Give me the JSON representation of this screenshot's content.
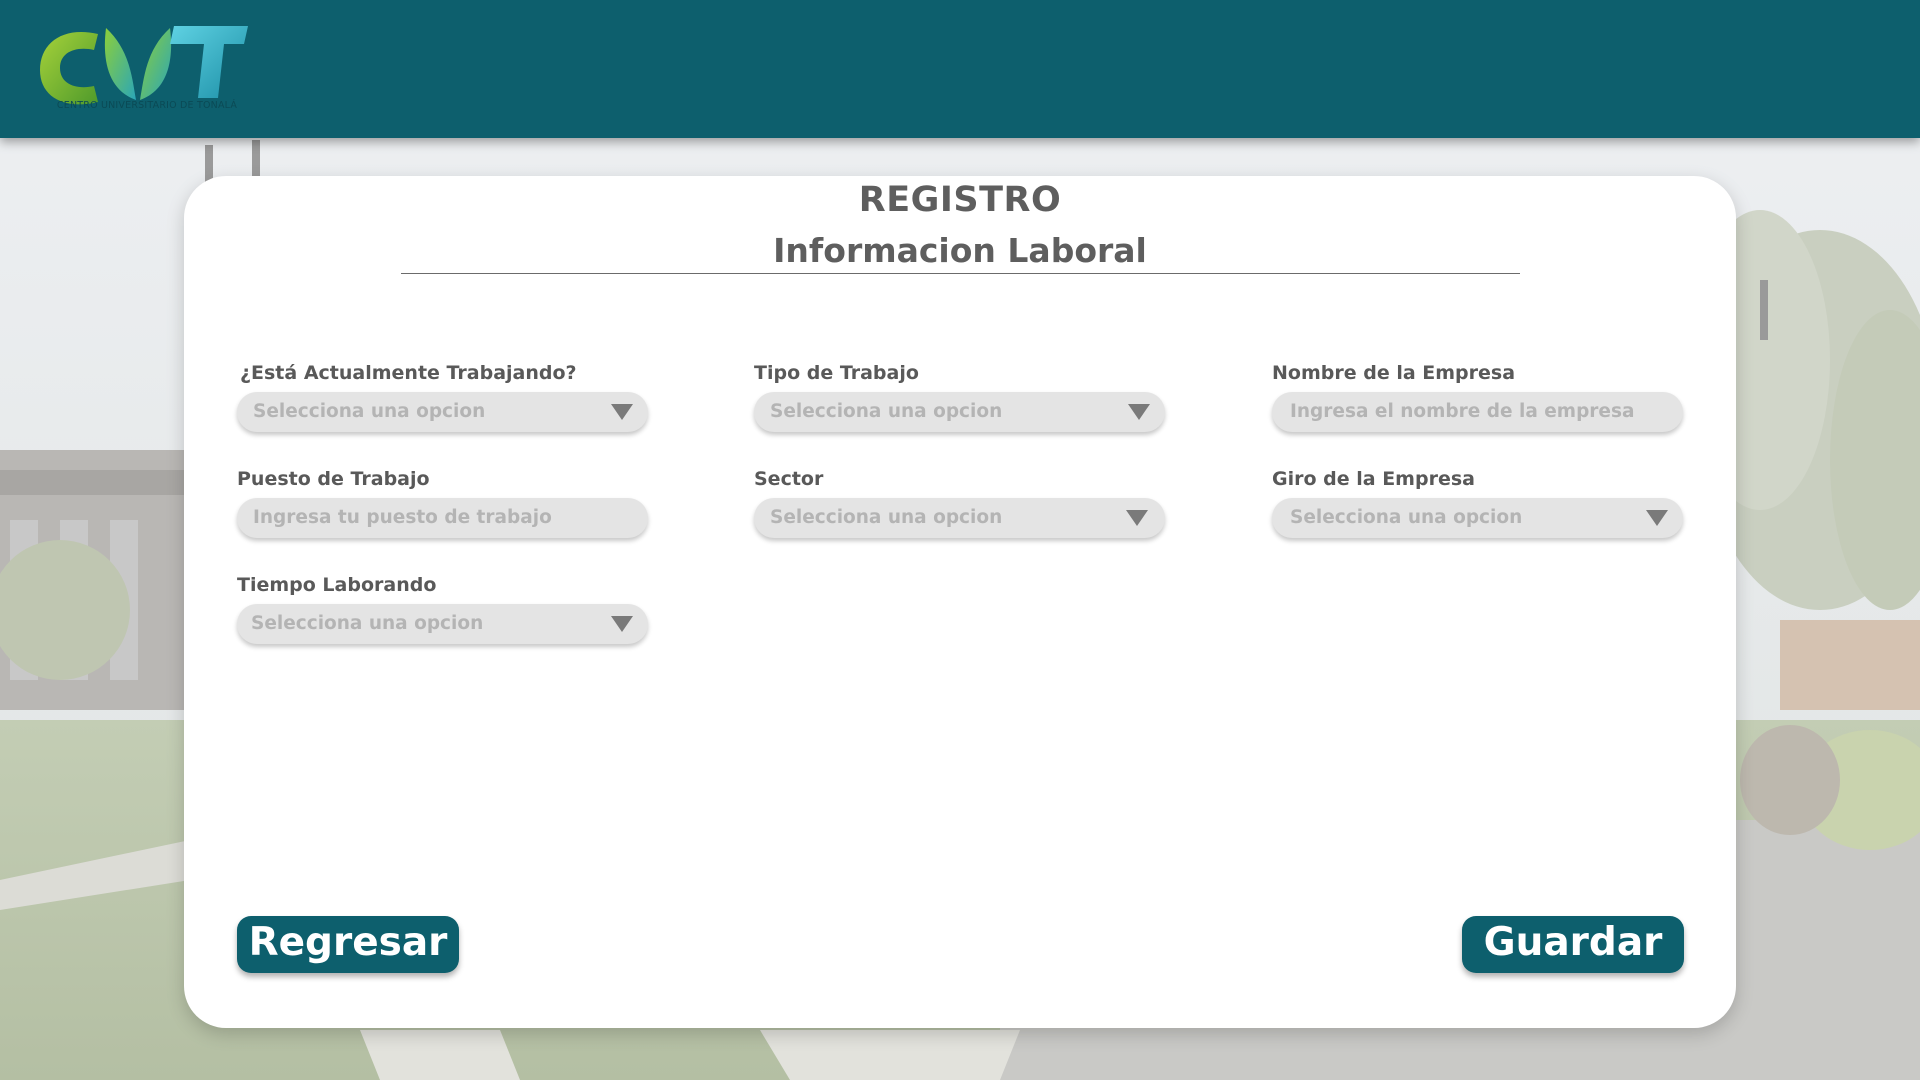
{
  "header": {
    "logo_letters": "CUT",
    "logo_caption": "CENTRO UNIVERSITARIO DE TONALÁ"
  },
  "form": {
    "title": "REGISTRO",
    "subtitle": "Informacion Laboral",
    "fields": {
      "working": {
        "label": "¿Está Actualmente Trabajando?",
        "placeholder": "Selecciona una opcion",
        "kind": "select"
      },
      "job_type": {
        "label": "Tipo de Trabajo",
        "placeholder": "Selecciona una opcion",
        "kind": "select"
      },
      "company_name": {
        "label": "Nombre de la Empresa",
        "placeholder": "Ingresa el nombre de la empresa",
        "kind": "text"
      },
      "job_position": {
        "label": "Puesto de Trabajo",
        "placeholder": "Ingresa tu puesto de trabajo",
        "kind": "text"
      },
      "sector": {
        "label": "Sector",
        "placeholder": "Selecciona una opcion",
        "kind": "select"
      },
      "company_line": {
        "label": "Giro de la Empresa",
        "placeholder": "Selecciona una opcion",
        "kind": "select"
      },
      "time_working": {
        "label": "Tiempo Laborando",
        "placeholder": "Selecciona una opcion",
        "kind": "select"
      }
    },
    "buttons": {
      "back": "Regresar",
      "save": "Guardar"
    }
  },
  "colors": {
    "brand": "#0d5f6d",
    "field_bg": "#e4e4e4",
    "label": "#595959",
    "placeholder": "#b4b4b4",
    "caret": "#7a7a7a"
  },
  "icons": {
    "dropdown": "caret-down-icon"
  }
}
